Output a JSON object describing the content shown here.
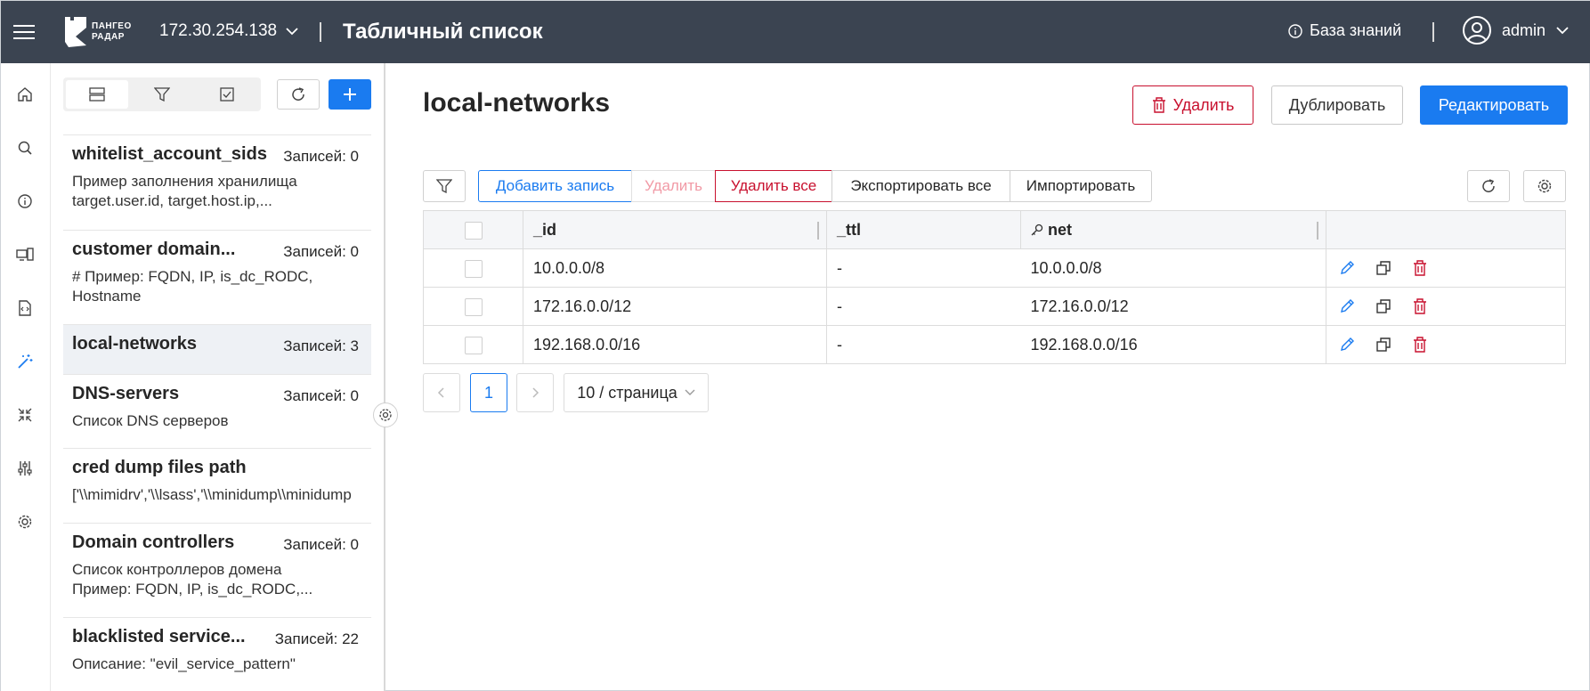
{
  "header": {
    "logo_text": "ПАНГЕО\nРАДАР",
    "host": "172.30.254.138",
    "page_title": "Табличный список",
    "knowledge_base": "База знаний",
    "user": "admin"
  },
  "rail": {
    "icons": [
      "home-icon",
      "search-icon",
      "info-icon",
      "devices-icon",
      "code-file-icon",
      "magic-wand-icon",
      "compress-icon",
      "sliders-icon",
      "settings-icon"
    ]
  },
  "list": {
    "items": [
      {
        "name": "whitelist_account_sids",
        "count": "Записей: 0",
        "desc": "Пример заполнения хранилища\ntarget.user.id, target.host.ip,..."
      },
      {
        "name": "customer domain...",
        "count": "Записей: 0",
        "desc": "# Пример: FQDN, IP, is_dc_RODC,\nHostname"
      },
      {
        "name": "local-networks",
        "count": "Записей: 3",
        "desc": ""
      },
      {
        "name": "DNS-servers",
        "count": "Записей: 0",
        "desc": "Список DNS серверов"
      },
      {
        "name": "cred dump files path",
        "count": "",
        "desc": "['\\\\mimidrv','\\\\lsass','\\\\minidump\\\\minidump"
      },
      {
        "name": "Domain controllers",
        "count": "Записей: 0",
        "desc": "Список контроллеров домена\nПример: FQDN, IP, is_dc_RODC,..."
      },
      {
        "name": "blacklisted service...",
        "count": "Записей: 22",
        "desc": "Описание: \"evil_service_pattern\""
      }
    ]
  },
  "main": {
    "title": "local-networks",
    "delete_label": "Удалить",
    "duplicate_label": "Дублировать",
    "edit_label": "Редактировать"
  },
  "toolbar": {
    "add_record": "Добавить запись",
    "delete": "Удалить",
    "delete_all": "Удалить все",
    "export_all": "Экспортировать все",
    "import": "Импортировать"
  },
  "table": {
    "columns": [
      "_id",
      "_ttl",
      "net"
    ],
    "rows": [
      {
        "id": "10.0.0.0/8",
        "ttl": "-",
        "net": "10.0.0.0/8"
      },
      {
        "id": "172.16.0.0/12",
        "ttl": "-",
        "net": "172.16.0.0/12"
      },
      {
        "id": "192.168.0.0/16",
        "ttl": "-",
        "net": "192.168.0.0/16"
      }
    ]
  },
  "pagination": {
    "current_page": "1",
    "page_size": "10 / страница"
  },
  "colors": {
    "topbar": "#3b4451",
    "primary": "#1a7bf0",
    "danger": "#c8102e"
  }
}
